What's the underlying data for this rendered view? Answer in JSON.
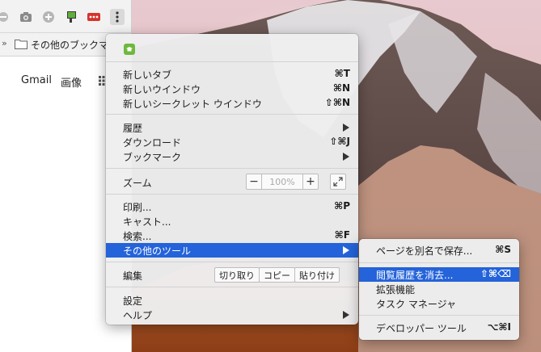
{
  "colors": {
    "highlight": "#2463d9",
    "menu_bg": "#eeeef0",
    "extension_green": "#6fb83e"
  },
  "browser": {
    "toolbar_icons": [
      "block-icon",
      "camera-icon",
      "puzzle-extension-icon",
      "green-extension-icon",
      "red-dots-extension-icon",
      "more-vert-icon"
    ],
    "bookmarks_bar": {
      "overflow": "»",
      "folder_label": "その他のブックマ"
    },
    "page_links": {
      "gmail": "Gmail",
      "images": "画像"
    }
  },
  "menu": {
    "new_tab": {
      "label": "新しいタブ",
      "shortcut": "⌘T"
    },
    "new_window": {
      "label": "新しいウインドウ",
      "shortcut": "⌘N"
    },
    "new_incognito": {
      "label": "新しいシークレット ウインドウ",
      "shortcut": "⇧⌘N"
    },
    "history": {
      "label": "履歴"
    },
    "downloads": {
      "label": "ダウンロード",
      "shortcut": "⇧⌘J"
    },
    "bookmarks": {
      "label": "ブックマーク"
    },
    "zoom": {
      "label": "ズーム",
      "minus": "−",
      "value": "100%",
      "plus": "+"
    },
    "print": {
      "label": "印刷...",
      "shortcut": "⌘P"
    },
    "cast": {
      "label": "キャスト..."
    },
    "find": {
      "label": "検索...",
      "shortcut": "⌘F"
    },
    "more_tools": {
      "label": "その他のツール"
    },
    "edit": {
      "label": "編集",
      "cut": "切り取り",
      "copy": "コピー",
      "paste": "貼り付け"
    },
    "settings": {
      "label": "設定"
    },
    "help": {
      "label": "ヘルプ"
    }
  },
  "submenu": {
    "save_page": {
      "label": "ページを別名で保存...",
      "shortcut": "⌘S"
    },
    "clear_browsing": {
      "label": "閲覧履歴を消去...",
      "shortcut": "⇧⌘⌫"
    },
    "extensions": {
      "label": "拡張機能"
    },
    "task_manager": {
      "label": "タスク マネージャ"
    },
    "developer_tools": {
      "label": "デベロッパー ツール",
      "shortcut": "⌥⌘I"
    }
  }
}
